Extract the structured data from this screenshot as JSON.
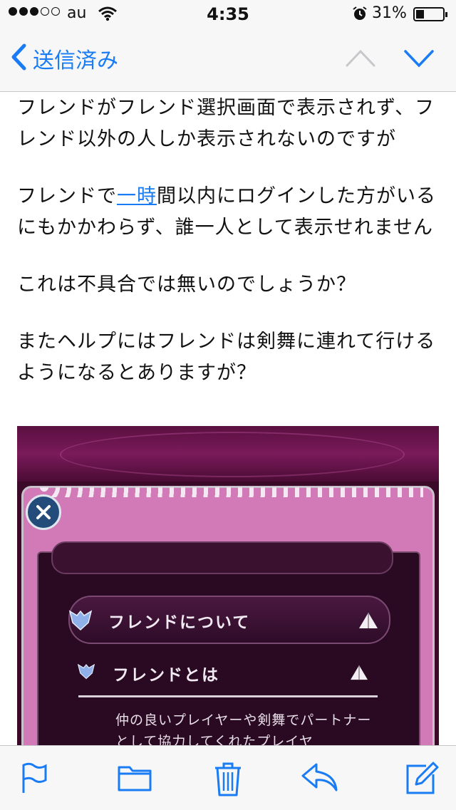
{
  "status_bar": {
    "carrier": "au",
    "time": "4:35",
    "battery": "31%",
    "battery_level": 0.31,
    "signal_dots_filled": 3,
    "signal_dots_total": 5
  },
  "nav": {
    "back_label": "送信済み"
  },
  "message": {
    "para1": "フレンドがフレンド選択画面で表示されず、フレンド以外の人しか表示されないのですが",
    "para2_before": "フレンドで",
    "para2_link": "一時",
    "para2_after": "間以内にログインした方がいるにもかかわらず、誰一人として表示せれません",
    "para3": "これは不具合では無いのでしょうか？",
    "para4": "またヘルプにはフレンドは剣舞に連れて行けるようになるとありますが？"
  },
  "attachment": {
    "row1_label": "フレンドについて",
    "row2_label": "フレンドとは",
    "description": "仲の良いプレイヤーや剣舞でパートナーとして協力してくれたプレイヤ"
  },
  "colors": {
    "accent": "#1a7cf4",
    "bar_background": "#f7f7f7",
    "game_pink": "#d27ab8",
    "game_dark": "#2a0a22"
  },
  "icons": {
    "toolbar": [
      "flag-icon",
      "folder-icon",
      "trash-icon",
      "reply-icon",
      "compose-icon"
    ],
    "nav": [
      "back-chevron-icon",
      "up-arrow-icon",
      "down-arrow-icon"
    ]
  }
}
